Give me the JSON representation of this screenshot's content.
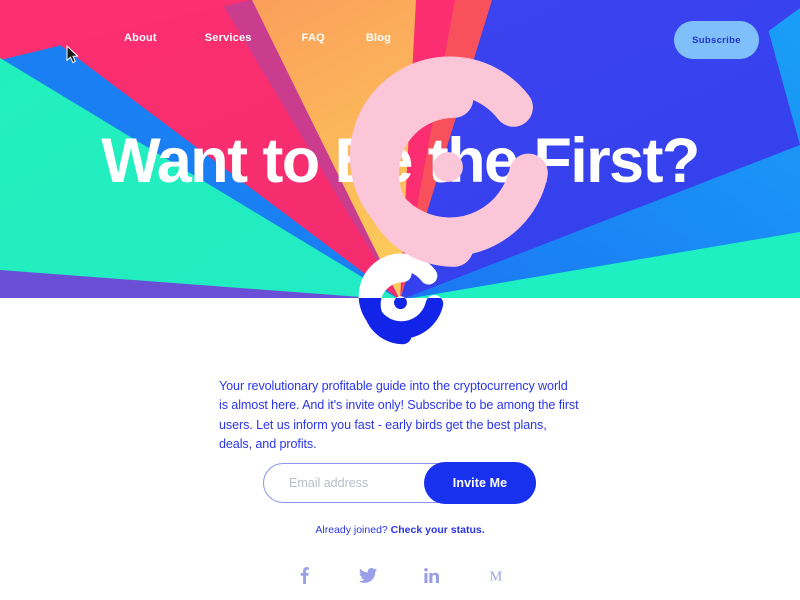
{
  "brand": {
    "logo_icon": "spiral-g-logo-icon",
    "accent_blue": "#1831EE",
    "accent_pink": "#FB2E71",
    "accent_orange": "#FBA94A",
    "accent_teal": "#23EDBE",
    "accent_bright_blue": "#1B91F5",
    "accent_indigo": "#3B43EE",
    "accent_magenta": "#C93C8E",
    "accent_red": "#F9515C",
    "accent_yellow": "#FBC95A",
    "text_blue": "#2B36E8",
    "subscribe_bg": "#7FC0FB",
    "subscribe_text": "#2233CC",
    "placeholder_grey": "#B9BDC9",
    "social_color": "#9AA0E8"
  },
  "nav": {
    "links": [
      {
        "label": "About"
      },
      {
        "label": "Services"
      },
      {
        "label": "FAQ"
      },
      {
        "label": "Blog"
      }
    ],
    "subscribe_label": "Subscribe"
  },
  "hero": {
    "headline": "Want to Be the First?"
  },
  "main": {
    "lede": "Your revolutionary profitable guide into the cryptocurrency world is almost here. And it's invite only! Subscribe to be among the first users. Let us inform you fast - early birds get the best plans, deals, and profits.",
    "form": {
      "email_placeholder": "Email address",
      "email_value": "",
      "submit_label": "Invite Me"
    },
    "already_joined": {
      "lead": "Already joined? ",
      "link_label": "Check your status."
    },
    "socials": [
      {
        "name": "facebook",
        "glyph": "f"
      },
      {
        "name": "twitter",
        "glyph": "bird"
      },
      {
        "name": "linkedin",
        "glyph": "in"
      },
      {
        "name": "medium",
        "glyph": "M"
      }
    ]
  }
}
